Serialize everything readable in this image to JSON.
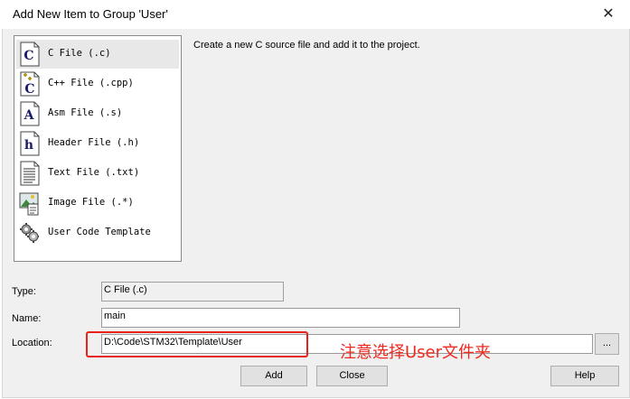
{
  "window": {
    "title": "Add New Item to Group 'User'",
    "close_glyph": "✕"
  },
  "file_types": [
    {
      "label": "C File (.c)",
      "icon": "c-file-icon",
      "selected": true
    },
    {
      "label": "C++ File (.cpp)",
      "icon": "cpp-file-icon",
      "selected": false
    },
    {
      "label": "Asm File (.s)",
      "icon": "asm-file-icon",
      "selected": false
    },
    {
      "label": "Header File (.h)",
      "icon": "header-file-icon",
      "selected": false
    },
    {
      "label": "Text File (.txt)",
      "icon": "text-file-icon",
      "selected": false
    },
    {
      "label": "Image File (.*)",
      "icon": "image-file-icon",
      "selected": false
    },
    {
      "label": "User Code Template",
      "icon": "gears-template-icon",
      "selected": false
    }
  ],
  "description": "Create a new C source file and add it to the project.",
  "form": {
    "type_label": "Type:",
    "type_value": "C File (.c)",
    "name_label": "Name:",
    "name_value": "main",
    "location_label": "Location:",
    "location_value": "D:\\Code\\STM32\\Template\\User",
    "browse_label": "..."
  },
  "buttons": {
    "add": "Add",
    "close": "Close",
    "help": "Help"
  },
  "annotation": {
    "text": "注意选择User文件夹",
    "color": "#f0281e"
  },
  "icon_glyphs": {
    "c": "C",
    "asm": "A",
    "header": "h"
  }
}
